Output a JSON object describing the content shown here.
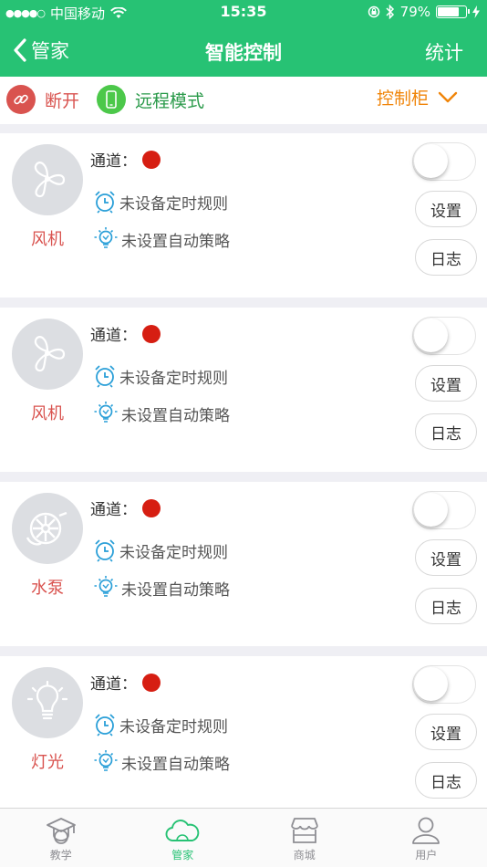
{
  "status": {
    "carrier": "中国移动",
    "time": "15:35",
    "battery": "79%",
    "battery_level": 0.79
  },
  "nav": {
    "back_label": "管家",
    "title": "智能控制",
    "right_label": "统计"
  },
  "modebar": {
    "disconnect_label": "断开",
    "mode_label": "远程模式",
    "cabinet_label": "控制柜"
  },
  "cards": [
    {
      "name": "风机",
      "icon": "fan-icon",
      "channel_label": "通道：",
      "timer_text": "未设备定时规则",
      "auto_text": "未设置自动策略",
      "toggle_on": false,
      "settings_label": "设置",
      "log_label": "日志"
    },
    {
      "name": "风机",
      "icon": "fan-icon",
      "channel_label": "通道：",
      "timer_text": "未设备定时规则",
      "auto_text": "未设置自动策略",
      "toggle_on": false,
      "settings_label": "设置",
      "log_label": "日志"
    },
    {
      "name": "水泵",
      "icon": "pump-icon",
      "channel_label": "通道：",
      "timer_text": "未设备定时规则",
      "auto_text": "未设置自动策略",
      "toggle_on": false,
      "settings_label": "设置",
      "log_label": "日志"
    },
    {
      "name": "灯光",
      "icon": "bulb-icon",
      "channel_label": "通道：",
      "timer_text": "未设备定时规则",
      "auto_text": "未设置自动策略",
      "toggle_on": false,
      "settings_label": "设置",
      "log_label": "日志"
    }
  ],
  "tabs": [
    {
      "label": "教学",
      "icon": "graduation-cap-icon",
      "active": false
    },
    {
      "label": "管家",
      "icon": "cloud-icon",
      "active": true
    },
    {
      "label": "商城",
      "icon": "store-icon",
      "active": false
    },
    {
      "label": "用户",
      "icon": "user-icon",
      "active": false
    }
  ],
  "colors": {
    "brand": "#27c274",
    "disconnect": "#d9534f",
    "mode": "#4cc84a",
    "cabinet": "#f0850a",
    "channel_dot": "#d61e12",
    "device_name": "#d9534f",
    "info_icon": "#2a9fd8"
  }
}
